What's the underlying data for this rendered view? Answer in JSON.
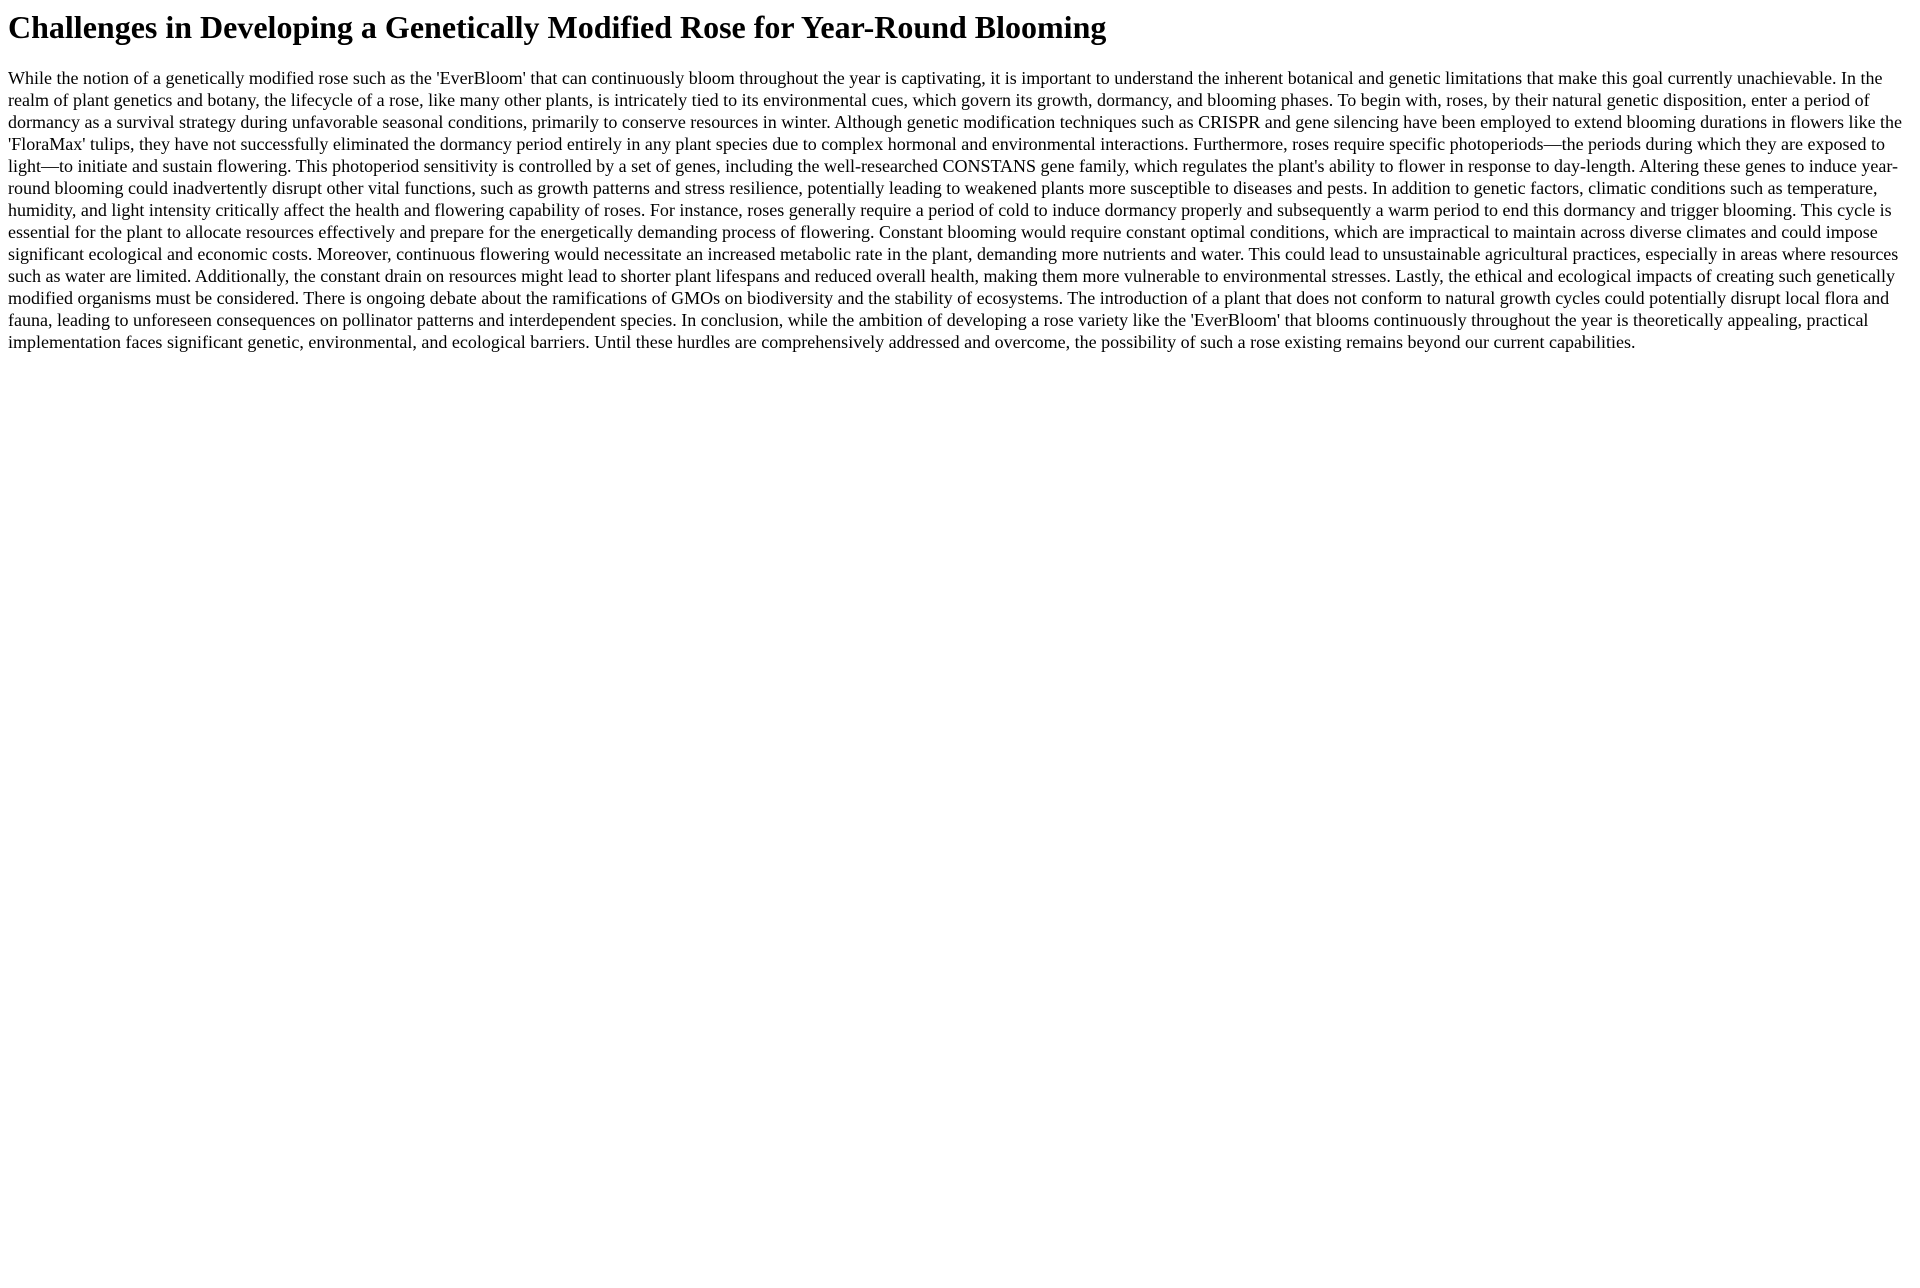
{
  "article": {
    "title": "Challenges in Developing a Genetically Modified Rose for Year-Round Blooming",
    "body": "While the notion of a genetically modified rose such as the 'EverBloom' that can continuously bloom throughout the year is captivating, it is important to understand the inherent botanical and genetic limitations that make this goal currently unachievable. In the realm of plant genetics and botany, the lifecycle of a rose, like many other plants, is intricately tied to its environmental cues, which govern its growth, dormancy, and blooming phases. To begin with, roses, by their natural genetic disposition, enter a period of dormancy as a survival strategy during unfavorable seasonal conditions, primarily to conserve resources in winter. Although genetic modification techniques such as CRISPR and gene silencing have been employed to extend blooming durations in flowers like the 'FloraMax' tulips, they have not successfully eliminated the dormancy period entirely in any plant species due to complex hormonal and environmental interactions. Furthermore, roses require specific photoperiods—the periods during which they are exposed to light—to initiate and sustain flowering. This photoperiod sensitivity is controlled by a set of genes, including the well-researched CONSTANS gene family, which regulates the plant's ability to flower in response to day-length. Altering these genes to induce year-round blooming could inadvertently disrupt other vital functions, such as growth patterns and stress resilience, potentially leading to weakened plants more susceptible to diseases and pests. In addition to genetic factors, climatic conditions such as temperature, humidity, and light intensity critically affect the health and flowering capability of roses. For instance, roses generally require a period of cold to induce dormancy properly and subsequently a warm period to end this dormancy and trigger blooming. This cycle is essential for the plant to allocate resources effectively and prepare for the energetically demanding process of flowering. Constant blooming would require constant optimal conditions, which are impractical to maintain across diverse climates and could impose significant ecological and economic costs. Moreover, continuous flowering would necessitate an increased metabolic rate in the plant, demanding more nutrients and water. This could lead to unsustainable agricultural practices, especially in areas where resources such as water are limited. Additionally, the constant drain on resources might lead to shorter plant lifespans and reduced overall health, making them more vulnerable to environmental stresses. Lastly, the ethical and ecological impacts of creating such genetically modified organisms must be considered. There is ongoing debate about the ramifications of GMOs on biodiversity and the stability of ecosystems. The introduction of a plant that does not conform to natural growth cycles could potentially disrupt local flora and fauna, leading to unforeseen consequences on pollinator patterns and interdependent species. In conclusion, while the ambition of developing a rose variety like the 'EverBloom' that blooms continuously throughout the year is theoretically appealing, practical implementation faces significant genetic, environmental, and ecological barriers. Until these hurdles are comprehensively addressed and overcome, the possibility of such a rose existing remains beyond our current capabilities."
  }
}
